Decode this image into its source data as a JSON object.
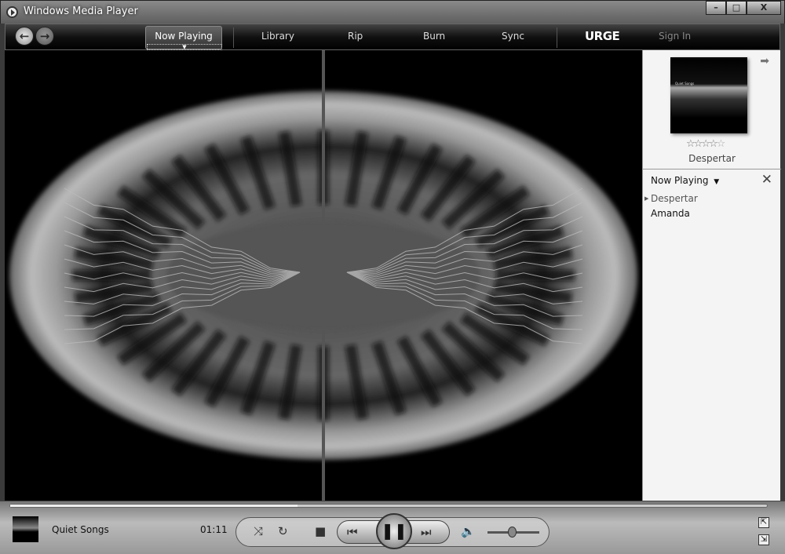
{
  "window": {
    "title": "Windows Media Player",
    "minimize": "–",
    "maximize": "□",
    "close": "X"
  },
  "nav": {
    "back": "←",
    "forward": "→",
    "tabs": [
      "Now Playing",
      "Library",
      "Rip",
      "Burn",
      "Sync"
    ],
    "store": "URGE",
    "sign_in": "Sign In"
  },
  "sidebar": {
    "album_art_text": "Quiet Songs",
    "rating": 3.5,
    "rating_max": 5,
    "now_playing_song": "Despertar",
    "list_title": "Now Playing",
    "playlist": [
      {
        "title": "Despertar",
        "current": true
      },
      {
        "title": "Amanda",
        "current": false
      }
    ]
  },
  "player": {
    "album": "Quiet Songs",
    "elapsed": "01:11",
    "progress": 0.38,
    "volume": 0.5
  },
  "colors": {
    "background": "#000000",
    "accent": "#ffffff"
  }
}
